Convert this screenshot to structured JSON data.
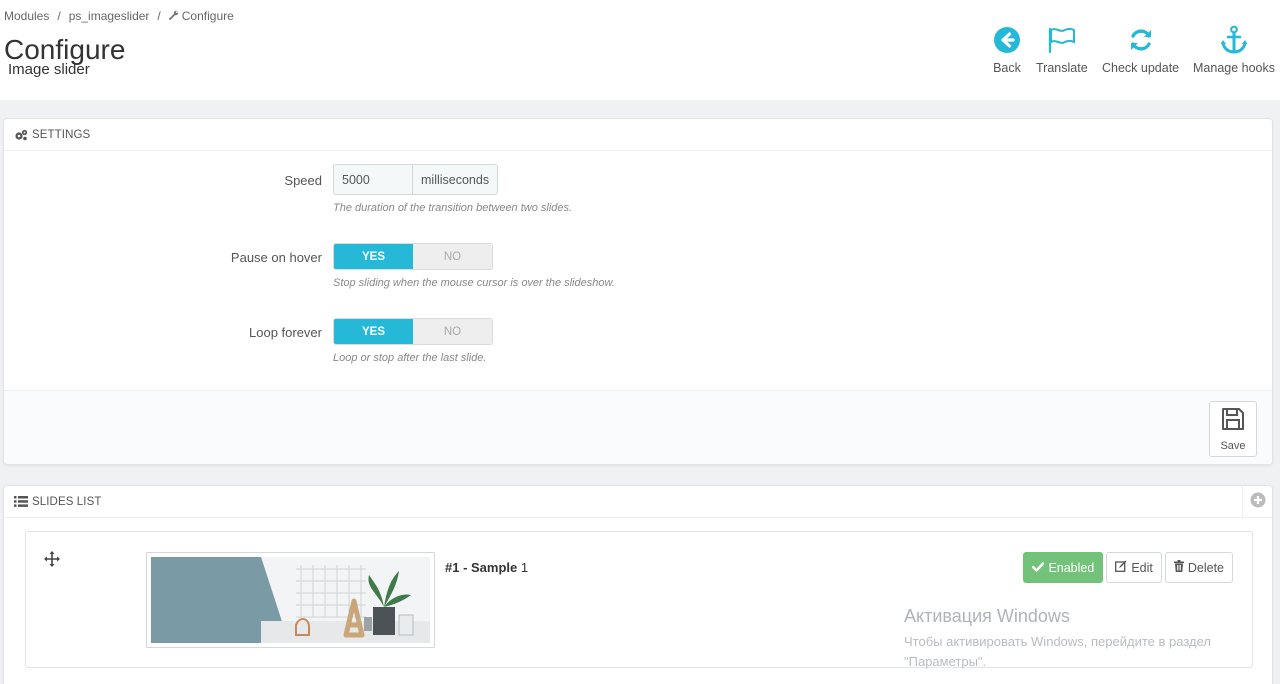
{
  "breadcrumb": {
    "items": [
      "Modules",
      "ps_imageslider",
      "Configure"
    ],
    "separator": "/"
  },
  "header": {
    "title": "Configure",
    "subtitle": "Image slider"
  },
  "toolbar": [
    {
      "label": "Back",
      "icon": "back-circle-arrow-icon"
    },
    {
      "label": "Translate",
      "icon": "flag-icon"
    },
    {
      "label": "Check update",
      "icon": "refresh-icon"
    },
    {
      "label": "Manage hooks",
      "icon": "anchor-icon"
    }
  ],
  "settings": {
    "heading": "SETTINGS",
    "speed": {
      "label": "Speed",
      "value": "5000",
      "unit": "milliseconds",
      "help": "The duration of the transition between two slides."
    },
    "pause_on_hover": {
      "label": "Pause on hover",
      "yes": "YES",
      "no": "NO",
      "selected": "YES",
      "help": "Stop sliding when the mouse cursor is over the slideshow."
    },
    "loop_forever": {
      "label": "Loop forever",
      "yes": "YES",
      "no": "NO",
      "selected": "YES",
      "help": "Loop or stop after the last slide."
    },
    "save_label": "Save"
  },
  "slides": {
    "heading": "SLIDES LIST",
    "items": [
      {
        "number": "#1 - ",
        "title": "Sample",
        "suffix": " 1",
        "status": "Enabled",
        "edit": "Edit",
        "delete": "Delete"
      }
    ]
  },
  "watermark": {
    "title": "Активация Windows",
    "line1": "Чтобы активировать Windows, перейдите в раздел",
    "line2": "\"Параметры\"."
  },
  "colors": {
    "accent": "#25b9d7",
    "enabled": "#72c279",
    "text": "#555555"
  }
}
